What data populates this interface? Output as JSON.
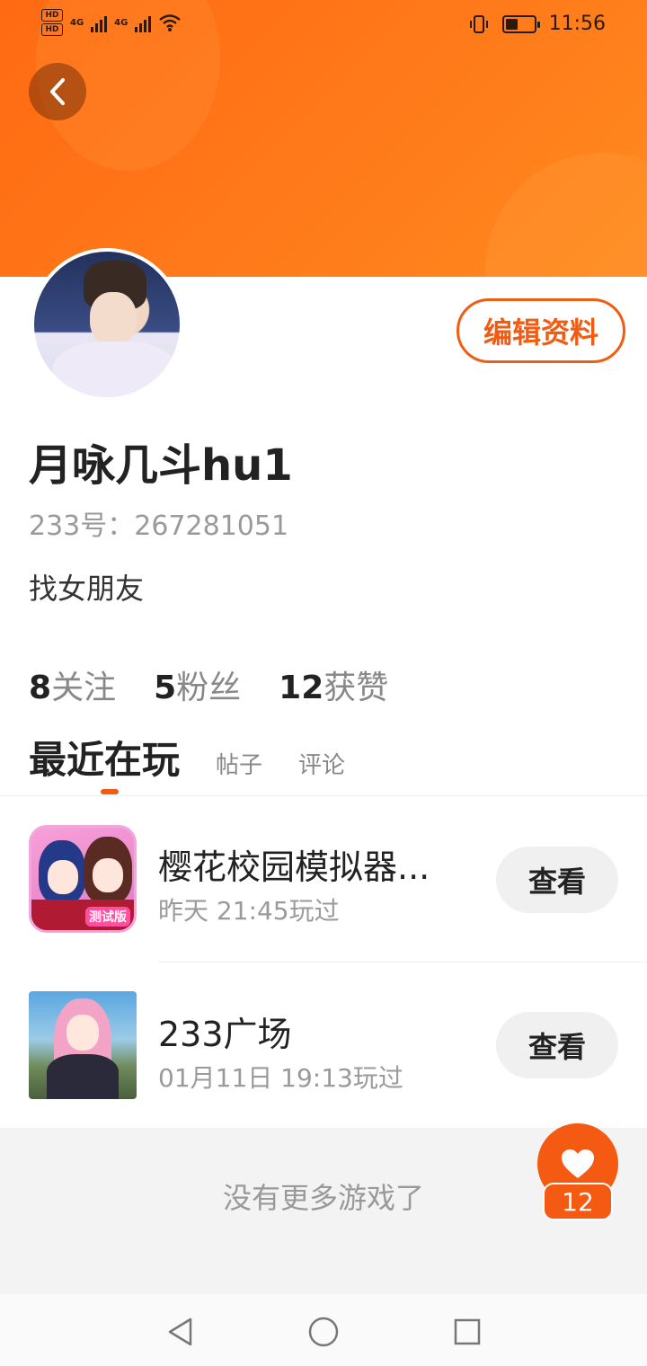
{
  "status_bar": {
    "time": "11:56",
    "hd1": "HD",
    "hd2": "HD",
    "net1": "4G",
    "net2": "4G",
    "battery_percent": 45
  },
  "profile": {
    "name": "月咏几斗hu1",
    "id_text": "233号：267281051",
    "bio": "找女朋友",
    "edit_label": "编辑资料"
  },
  "stats": [
    {
      "num": "8",
      "label": "关注"
    },
    {
      "num": "5",
      "label": "粉丝"
    },
    {
      "num": "12",
      "label": "获赞"
    }
  ],
  "tabs": {
    "active": "最近在玩",
    "posts": "帖子",
    "comments": "评论"
  },
  "games": [
    {
      "title": "樱花校园模拟器...",
      "played": "昨天 21:45玩过",
      "button": "查看",
      "badge": "测试版"
    },
    {
      "title": "233广场",
      "played": "01月11日 19:13玩过",
      "button": "查看"
    }
  ],
  "footer": {
    "no_more": "没有更多游戏了"
  },
  "like_fab": {
    "count": "12"
  },
  "colors": {
    "accent": "#f25c12",
    "header": "#ff7a1a"
  }
}
